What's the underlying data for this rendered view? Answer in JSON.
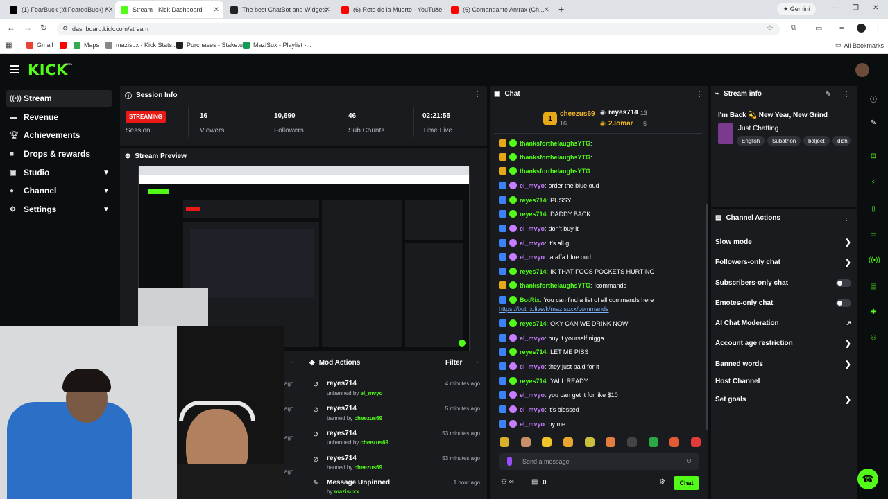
{
  "browser": {
    "tabs": [
      {
        "title": "(1) FearBuck (@FearedBuck) / X",
        "color": "#000000"
      },
      {
        "title": "Stream - Kick Dashboard",
        "color": "#53fc18"
      },
      {
        "title": "The best ChatBot and Widgets",
        "color": "#222222"
      },
      {
        "title": "(6) Reto de la Muerte - YouTube",
        "color": "#ff0000"
      },
      {
        "title": "(6) Comandante Antrax (Ch...",
        "color": "#ff0000"
      }
    ],
    "gemini_label": "Gemini",
    "url": "dashboard.kick.com/stream",
    "bookmarks": [
      "Gmail",
      "Maps",
      "mazisux - Kick Stats,...",
      "Purchases - Stake.us",
      "MaziSux - Playlist -..."
    ],
    "all_bookmarks": "All Bookmarks"
  },
  "app": {
    "logo": "KICK",
    "logo_badge": "BETA",
    "accent": "#53fc18"
  },
  "sidebar": {
    "items": [
      {
        "label": "Stream",
        "icon": "broadcast-icon"
      },
      {
        "label": "Revenue",
        "icon": "money-icon"
      },
      {
        "label": "Achievements",
        "icon": "trophy-icon"
      },
      {
        "label": "Drops & rewards",
        "icon": "gift-icon"
      },
      {
        "label": "Studio",
        "icon": "film-icon"
      },
      {
        "label": "Channel",
        "icon": "user-icon"
      },
      {
        "label": "Settings",
        "icon": "gear-icon"
      }
    ]
  },
  "session": {
    "title": "Session Info",
    "badge": "STREAMING",
    "session_label": "Session",
    "viewers": "16",
    "viewers_label": "Viewers",
    "followers": "10,690",
    "followers_label": "Followers",
    "subs": "46",
    "subs_label": "Sub Counts",
    "time": "02:21:55",
    "time_label": "Time Live"
  },
  "preview": {
    "title": "Stream Preview"
  },
  "mod": {
    "title": "Mod Actions",
    "filter": "Filter",
    "left_agos": [
      "ago",
      "ago",
      "ago",
      "ago"
    ],
    "entries": [
      {
        "user": "reyes714",
        "action": "unbanned by",
        "by": "el_mvyo",
        "ago": "4 minutes ago",
        "icon": "undo-icon"
      },
      {
        "user": "reyes714",
        "action": "banned by",
        "by": "cheezus69",
        "ago": "5 minutes ago",
        "icon": "ban-icon"
      },
      {
        "user": "reyes714",
        "action": "unbanned by",
        "by": "cheezus69",
        "ago": "53 minutes ago",
        "icon": "undo-icon"
      },
      {
        "user": "reyes714",
        "action": "banned by",
        "by": "cheezus69",
        "ago": "53 minutes ago",
        "icon": "ban-icon"
      },
      {
        "user": "Message Unpinned",
        "action": "by",
        "by": "mazisuxx",
        "ago": "1 hour ago",
        "icon": "unpin-icon"
      }
    ]
  },
  "chat": {
    "title": "Chat",
    "leaders": [
      {
        "rank": "1",
        "name": "cheezus69",
        "count": "16"
      },
      {
        "name": "reyes714",
        "count": "13"
      },
      {
        "name": "2Jomar",
        "count": "5"
      }
    ],
    "messages": [
      {
        "user": "thanksforthelaughsYTG",
        "color": "#53fc18",
        "text": ""
      },
      {
        "user": "thanksforthelaughsYTG",
        "color": "#53fc18",
        "text": ""
      },
      {
        "user": "thanksforthelaughsYTG",
        "color": "#53fc18",
        "text": ""
      },
      {
        "user": "el_mvyo",
        "color": "#c77dff",
        "text": "order the blue oud"
      },
      {
        "user": "reyes714",
        "color": "#53fc18",
        "text": "PUSSY"
      },
      {
        "user": "reyes714",
        "color": "#53fc18",
        "text": "DADDY BACK"
      },
      {
        "user": "el_mvyo",
        "color": "#c77dff",
        "text": "don't buy it"
      },
      {
        "user": "el_mvyo",
        "color": "#c77dff",
        "text": "it's all g"
      },
      {
        "user": "el_mvyo",
        "color": "#c77dff",
        "text": "lataffa blue oud"
      },
      {
        "user": "reyes714",
        "color": "#53fc18",
        "text": "IK THAT FOOS POCKETS HURTING"
      },
      {
        "user": "thanksforthelaughsYTG",
        "color": "#53fc18",
        "text": "!commands"
      },
      {
        "user": "BotRix",
        "color": "#53fc18",
        "text": "You can find a list of all commands here"
      },
      {
        "user": "",
        "color": "#7fb2ff",
        "text": "https://botrix.live/k/mazisuxx/commands"
      },
      {
        "user": "reyes714",
        "color": "#53fc18",
        "text": "OKY CAN WE DRINK NOW"
      },
      {
        "user": "el_mvyo",
        "color": "#c77dff",
        "text": "buy it yourself nigga"
      },
      {
        "user": "reyes714",
        "color": "#53fc18",
        "text": "LET ME PISS"
      },
      {
        "user": "el_mvyo",
        "color": "#c77dff",
        "text": "they just paid for it"
      },
      {
        "user": "reyes714",
        "color": "#53fc18",
        "text": "YALL READY"
      },
      {
        "user": "el_mvyo",
        "color": "#c77dff",
        "text": "you can get it for like $10"
      },
      {
        "user": "el_mvyo",
        "color": "#c77dff",
        "text": "it's blessed"
      },
      {
        "user": "el_mvyo",
        "color": "#c77dff",
        "text": "by me"
      }
    ],
    "input_placeholder": "Send a message",
    "points": "0",
    "send": "Chat"
  },
  "stream_info": {
    "title": "Stream info",
    "stream_title": "I'm Back 💫 New Year, New Grind",
    "category": "Just Chatting",
    "tags": [
      "English",
      "Subathon",
      "baljeet",
      "dish"
    ]
  },
  "channel_actions": {
    "title": "Channel Actions",
    "items": [
      {
        "label": "Slow mode",
        "kind": "chevron"
      },
      {
        "label": "Followers-only chat",
        "kind": "chevron"
      },
      {
        "label": "Subscribers-only chat",
        "kind": "toggle"
      },
      {
        "label": "Emotes-only chat",
        "kind": "toggle"
      },
      {
        "label": "AI Chat Moderation",
        "kind": "external"
      },
      {
        "label": "Account age restriction",
        "kind": "chevron"
      },
      {
        "label": "Banned words",
        "kind": "chevron"
      },
      {
        "label": "Host Channel",
        "kind": "none"
      },
      {
        "label": "Set goals",
        "kind": "chevron"
      }
    ]
  }
}
